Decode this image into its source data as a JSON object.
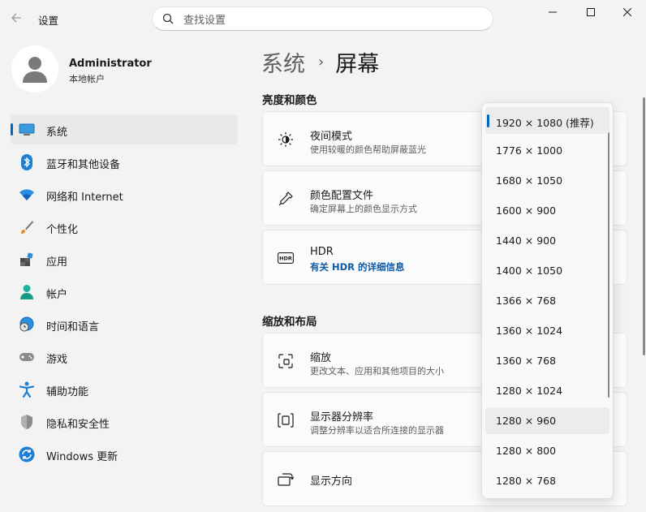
{
  "window": {
    "title": "设置"
  },
  "search": {
    "placeholder": "查找设置"
  },
  "profile": {
    "name": "Administrator",
    "account_type": "本地帐户"
  },
  "sidebar": {
    "items": [
      {
        "label": "系统",
        "icon": "system-icon",
        "active": true
      },
      {
        "label": "蓝牙和其他设备",
        "icon": "bluetooth-icon"
      },
      {
        "label": "网络和 Internet",
        "icon": "wifi-icon"
      },
      {
        "label": "个性化",
        "icon": "paintbrush-icon"
      },
      {
        "label": "应用",
        "icon": "apps-icon"
      },
      {
        "label": "帐户",
        "icon": "account-icon"
      },
      {
        "label": "时间和语言",
        "icon": "globe-clock-icon"
      },
      {
        "label": "游戏",
        "icon": "gamepad-icon"
      },
      {
        "label": "辅助功能",
        "icon": "accessibility-icon"
      },
      {
        "label": "隐私和安全性",
        "icon": "shield-icon"
      },
      {
        "label": "Windows 更新",
        "icon": "update-icon"
      }
    ]
  },
  "breadcrumb": {
    "parent": "系统",
    "separator": "›",
    "current": "屏幕"
  },
  "sections": {
    "brightness": {
      "heading": "亮度和颜色",
      "night_light": {
        "title": "夜间模式",
        "subtitle": "使用较暖的颜色帮助屏蔽蓝光"
      },
      "color_profile": {
        "title": "颜色配置文件",
        "subtitle": "确定屏幕上的颜色显示方式"
      },
      "hdr": {
        "title": "HDR",
        "link": "有关 HDR 的详细信息"
      }
    },
    "scale_layout": {
      "heading": "缩放和布局",
      "scale": {
        "title": "缩放",
        "subtitle": "更改文本、应用和其他项目的大小"
      },
      "resolution": {
        "title": "显示器分辨率",
        "subtitle": "调整分辨率以适合所连接的显示器"
      },
      "orientation": {
        "title": "显示方向"
      }
    }
  },
  "resolution_dropdown": {
    "selected_index": 0,
    "hover_index": 10,
    "options": [
      "1920 × 1080 (推荐)",
      "1776 × 1000",
      "1680 × 1050",
      "1600 × 900",
      "1440 × 900",
      "1400 × 1050",
      "1366 × 768",
      "1360 × 1024",
      "1360 × 768",
      "1280 × 1024",
      "1280 × 960",
      "1280 × 800",
      "1280 × 768"
    ]
  },
  "colors": {
    "accent": "#0067c0",
    "background": "#f3f3f3",
    "card": "#fbfbfb"
  }
}
